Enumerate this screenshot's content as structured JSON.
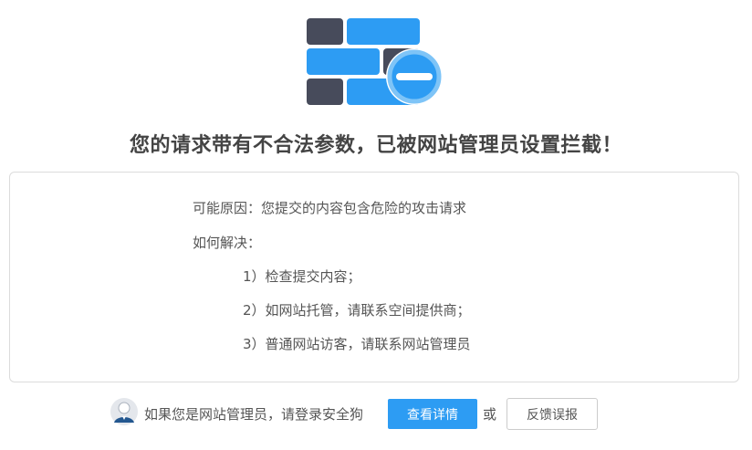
{
  "icon": {
    "name": "firewall-blocked-icon",
    "colors": {
      "brick_dark": "#474b5b",
      "brick_blue": "#2d9cf3",
      "badge_ring": "#7ec4f7",
      "badge_bar": "#6db9f2"
    }
  },
  "headline": "您的请求带有不合法参数，已被网站管理员设置拦截！",
  "details": {
    "reason_label": "可能原因：",
    "reason_text": "您提交的内容包含危险的攻击请求",
    "solution_label": "如何解决：",
    "steps": [
      "1）检查提交内容；",
      "2）如网站托管，请联系空间提供商；",
      "3）普通网站访客，请联系网站管理员"
    ]
  },
  "footer": {
    "admin_prompt": "如果您是网站管理员，请登录安全狗",
    "details_button": "查看详情",
    "or_text": "或",
    "report_button": "反馈误报",
    "colors": {
      "primary": "#2d9cf3",
      "avatar_bg": "#e4e7ec",
      "avatar_body": "#23578f"
    }
  }
}
